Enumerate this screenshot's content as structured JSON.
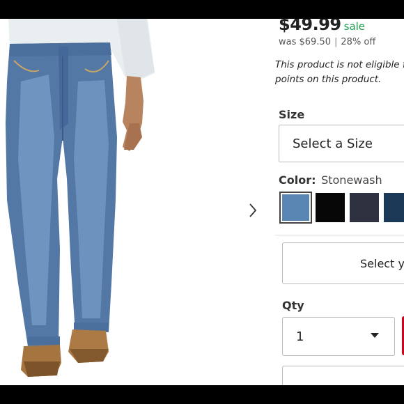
{
  "product": {
    "price": "$49.99",
    "sale_label": "sale",
    "was_label": "was",
    "was_price": "$69.50",
    "separator": "|",
    "discount": "28% off",
    "notice_line1": "This product is not eligible for",
    "notice_line2": "points on this product."
  },
  "size": {
    "label": "Size",
    "placeholder": "Select a Size"
  },
  "color": {
    "label": "Color:",
    "selected": "Stonewash",
    "swatches": [
      {
        "name": "stonewash",
        "color": "#5a86b3",
        "selected": true
      },
      {
        "name": "black",
        "color": "#070707",
        "selected": false
      },
      {
        "name": "dark-gray",
        "color": "#2e3240",
        "selected": false
      },
      {
        "name": "navy",
        "color": "#1b3856",
        "selected": false
      }
    ]
  },
  "store": {
    "button_label": "Select y"
  },
  "qty": {
    "label": "Qty",
    "value": "1"
  },
  "colors": {
    "sale_green": "#1a9b4b",
    "add_to_cart_red": "#d0021b"
  }
}
